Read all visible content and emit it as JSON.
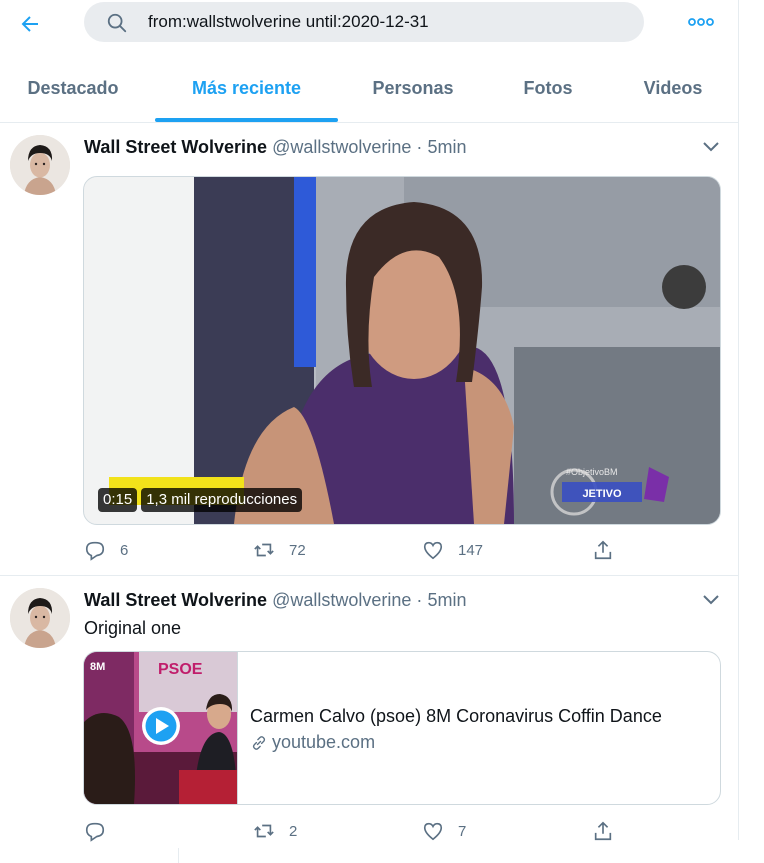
{
  "search": {
    "query": "from:wallstwolverine until:2020-12-31"
  },
  "tabs": [
    {
      "label": "Destacado"
    },
    {
      "label": "Más reciente"
    },
    {
      "label": "Personas"
    },
    {
      "label": "Fotos"
    },
    {
      "label": "Videos"
    }
  ],
  "active_tab": "Más reciente",
  "colors": {
    "accent": "#1da1f2",
    "secondary_text": "#5b7083",
    "border": "#e6ecf0"
  },
  "tweets": [
    {
      "name": "Wall Street Wolverine",
      "handle": "@wallstwolverine",
      "separator": "·",
      "time": "5min",
      "media": {
        "duration": "0:15",
        "views": "1,3 mil reproducciones",
        "overlay_tag": "#ObjetivoBM",
        "overlay_logo": "JETIVO"
      },
      "replies": "6",
      "retweets": "72",
      "likes": "147"
    },
    {
      "name": "Wall Street Wolverine",
      "handle": "@wallstwolverine",
      "separator": "·",
      "time": "5min",
      "text": "Original one",
      "card": {
        "title": "Carmen Calvo (psoe) 8M Coronavirus Coffin Dance",
        "domain": "youtube.com",
        "thumb_tag": "8M",
        "thumb_brand": "PSOE"
      },
      "replies": "",
      "retweets": "2",
      "likes": "7"
    }
  ]
}
